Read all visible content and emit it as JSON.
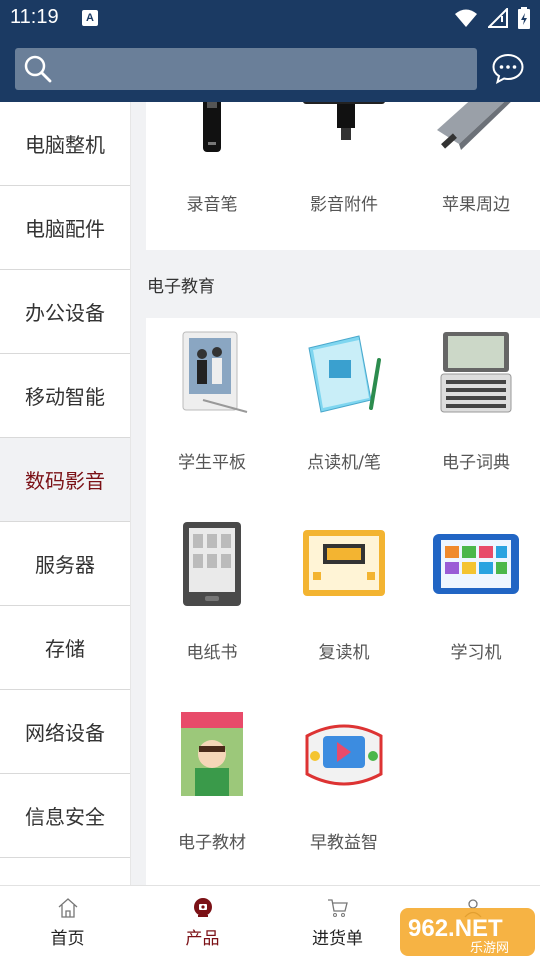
{
  "status": {
    "time": "11:19",
    "notif_letter": "A"
  },
  "search": {
    "placeholder": ""
  },
  "sidebar": {
    "items": [
      {
        "label": "电脑整机"
      },
      {
        "label": "电脑配件"
      },
      {
        "label": "办公设备"
      },
      {
        "label": "移动智能"
      },
      {
        "label": "数码影音",
        "active": true
      },
      {
        "label": "服务器"
      },
      {
        "label": "存储"
      },
      {
        "label": "网络设备"
      },
      {
        "label": "信息安全"
      }
    ]
  },
  "top_row": [
    {
      "label": "录音笔",
      "icon": "voice-recorder-icon"
    },
    {
      "label": "影音附件",
      "icon": "camera-light-icon"
    },
    {
      "label": "苹果周边",
      "icon": "usb-hub-icon"
    }
  ],
  "section": {
    "title": "电子教育",
    "items": [
      {
        "label": "学生平板",
        "icon": "student-tablet-icon"
      },
      {
        "label": "点读机/笔",
        "icon": "reading-pen-icon"
      },
      {
        "label": "电子词典",
        "icon": "e-dictionary-icon"
      },
      {
        "label": "电纸书",
        "icon": "e-reader-icon"
      },
      {
        "label": "复读机",
        "icon": "repeater-icon"
      },
      {
        "label": "学习机",
        "icon": "learning-machine-icon"
      },
      {
        "label": "电子教材",
        "icon": "e-textbook-icon"
      },
      {
        "label": "早教益智",
        "icon": "early-learning-icon"
      }
    ]
  },
  "tabbar": {
    "items": [
      {
        "label": "首页",
        "icon": "home-icon"
      },
      {
        "label": "产品",
        "icon": "product-icon",
        "active": true
      },
      {
        "label": "进货单",
        "icon": "cart-icon"
      },
      {
        "label": "",
        "icon": "user-icon"
      }
    ]
  },
  "watermark": {
    "text": "962.NET",
    "subtext": "乐游网"
  },
  "colors": {
    "header": "#1b3a63",
    "accent": "#7b1116",
    "background": "#f1f2f4"
  }
}
